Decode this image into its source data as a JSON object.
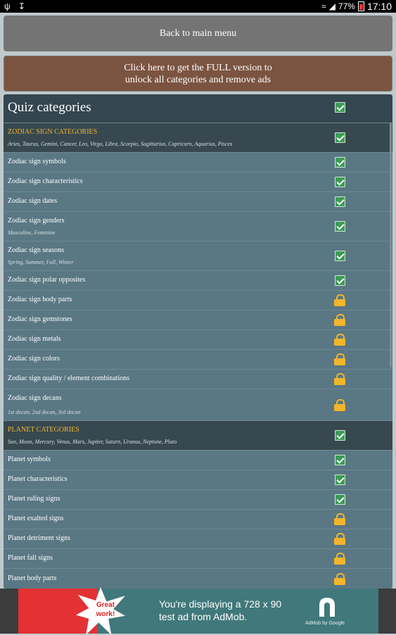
{
  "status_bar": {
    "battery": "77%",
    "time": "17:10",
    "icons": [
      "usb-icon",
      "download-icon",
      "wifi-icon",
      "signal-icon",
      "battery-icon"
    ]
  },
  "buttons": {
    "back": "Back to main menu",
    "full_line1": "Click here to get the FULL version to",
    "full_line2": "unlock all categories and remove ads"
  },
  "panel": {
    "title": "Quiz categories"
  },
  "rows": [
    {
      "type": "group",
      "label": "ZODIAC SIGN CATEGORIES",
      "sub": "Aries, Taurus, Gemini, Cancer, Leo, Virgo, Libra, Scorpio, Sagittarius, Capricorn, Aquarius, Pisces",
      "status": "check"
    },
    {
      "type": "item",
      "label": "Zodiac sign symbols",
      "sub": "",
      "status": "check"
    },
    {
      "type": "item",
      "label": "Zodiac sign characteristics",
      "sub": "",
      "status": "check"
    },
    {
      "type": "item",
      "label": "Zodiac sign dates",
      "sub": "",
      "status": "check"
    },
    {
      "type": "item",
      "label": "Zodiac sign genders",
      "sub": "Masculine, Feminine",
      "status": "check"
    },
    {
      "type": "item",
      "label": "Zodiac sign seasons",
      "sub": "Spring, Summer, Fall, Winter",
      "status": "check"
    },
    {
      "type": "item",
      "label": "Zodiac sign polar opposites",
      "sub": "",
      "status": "check"
    },
    {
      "type": "item",
      "label": "Zodiac sign body parts",
      "sub": "",
      "status": "lock"
    },
    {
      "type": "item",
      "label": "Zodiac sign gemstones",
      "sub": "",
      "status": "lock"
    },
    {
      "type": "item",
      "label": "Zodiac sign metals",
      "sub": "",
      "status": "lock"
    },
    {
      "type": "item",
      "label": "Zodiac sign colors",
      "sub": "",
      "status": "lock"
    },
    {
      "type": "item",
      "label": "Zodiac sign quality / element combinations",
      "sub": "",
      "status": "lock"
    },
    {
      "type": "item",
      "label": "Zodiac sign decans",
      "sub": "1st decan, 2nd decan, 3rd decan",
      "status": "lock"
    },
    {
      "type": "group",
      "label": "PLANET CATEGORIES",
      "sub": "Sun, Moon, Mercury, Venus, Mars, Jupiter, Saturn, Uranus, Neptune, Pluto",
      "status": "check"
    },
    {
      "type": "item",
      "label": "Planet symbols",
      "sub": "",
      "status": "check"
    },
    {
      "type": "item",
      "label": "Planet characteristics",
      "sub": "",
      "status": "check"
    },
    {
      "type": "item",
      "label": "Planet ruling signs",
      "sub": "",
      "status": "check"
    },
    {
      "type": "item",
      "label": "Planet exalted signs",
      "sub": "",
      "status": "lock"
    },
    {
      "type": "item",
      "label": "Planet detriment signs",
      "sub": "",
      "status": "lock"
    },
    {
      "type": "item",
      "label": "Planet fall signs",
      "sub": "",
      "status": "lock"
    },
    {
      "type": "item",
      "label": "Planet body parts",
      "sub": "",
      "status": "lock"
    }
  ],
  "ad": {
    "badge_line1": "Great",
    "badge_line2": "work!",
    "text_line1": "You're displaying a 728 x 90",
    "text_line2": "test ad from AdMob.",
    "logo_caption": "AdMob by Google"
  }
}
